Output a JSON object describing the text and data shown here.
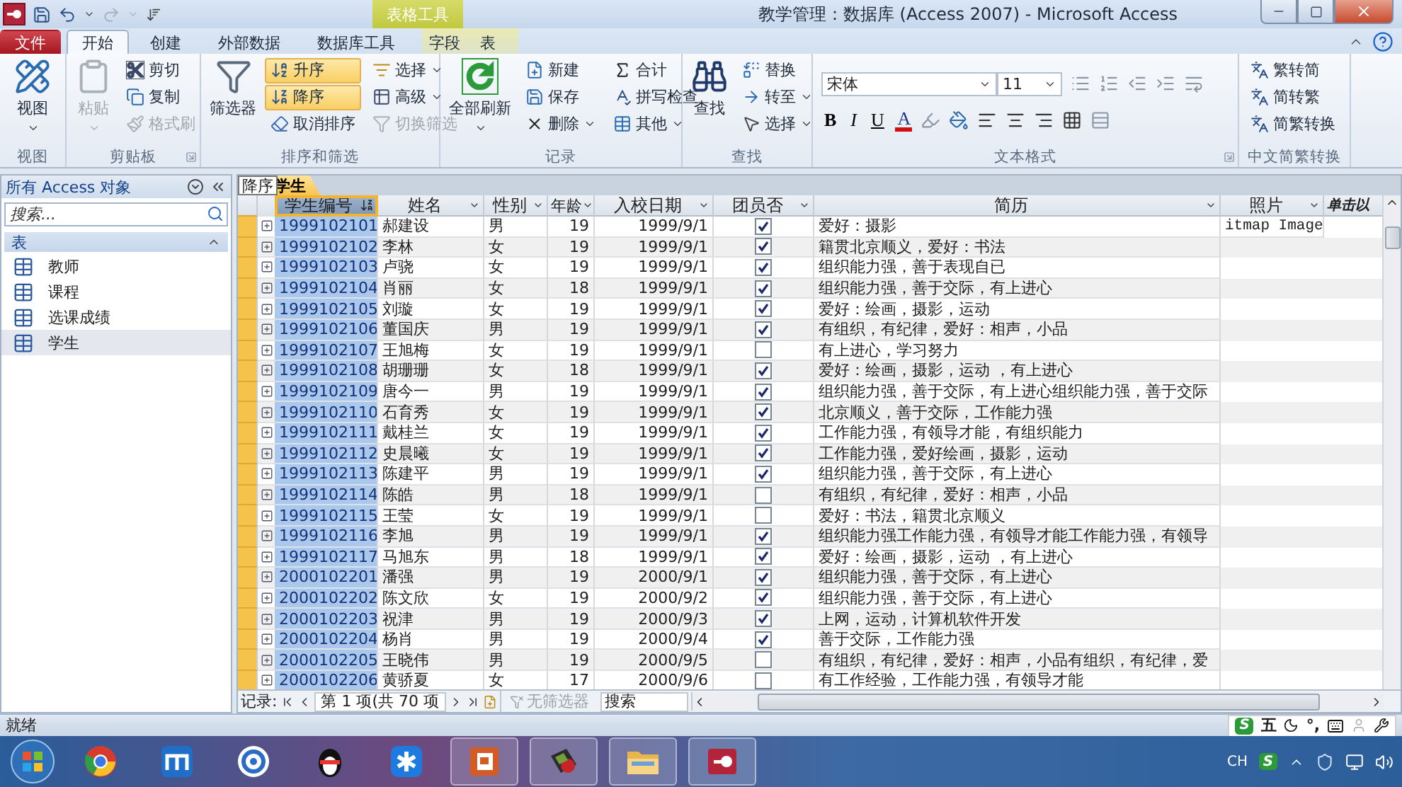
{
  "title_bar": {
    "context_group": "表格工具",
    "title": "教学管理：数据库 (Access 2007)  -  Microsoft Access"
  },
  "tabs": [
    {
      "label": "文件",
      "kind": "file",
      "selected": false
    },
    {
      "label": "开始",
      "kind": "tab",
      "selected": true
    },
    {
      "label": "创建",
      "kind": "tab",
      "selected": false
    },
    {
      "label": "外部数据",
      "kind": "tab",
      "selected": false
    },
    {
      "label": "数据库工具",
      "kind": "tab",
      "selected": false
    },
    {
      "label": "字段",
      "kind": "context",
      "selected": false
    },
    {
      "label": "表",
      "kind": "context",
      "selected": false
    }
  ],
  "ribbon": [
    {
      "kind": "buttons",
      "caption": "视图",
      "launcher": false,
      "items": [
        {
          "kind": "large",
          "label": "视图",
          "dropdown": true,
          "disabled": false,
          "highlighted": false
        }
      ]
    },
    {
      "kind": "buttons",
      "caption": "剪贴板",
      "launcher": true,
      "items": [
        {
          "kind": "large",
          "label": "粘贴",
          "dropdown": true,
          "disabled": true,
          "highlighted": false
        },
        {
          "kind": "small",
          "label": "剪切",
          "dropdown": false,
          "disabled": false,
          "highlighted": false
        },
        {
          "kind": "small",
          "label": "复制",
          "dropdown": false,
          "disabled": false,
          "highlighted": false
        },
        {
          "kind": "small",
          "label": "格式刷",
          "dropdown": false,
          "disabled": true,
          "highlighted": false
        }
      ]
    },
    {
      "kind": "buttons",
      "caption": "排序和筛选",
      "launcher": false,
      "items": [
        {
          "kind": "large",
          "label": "筛选器",
          "dropdown": false,
          "disabled": false,
          "highlighted": false
        },
        {
          "kind": "small",
          "label": "升序",
          "dropdown": false,
          "disabled": false,
          "highlighted": true
        },
        {
          "kind": "small",
          "label": "降序",
          "dropdown": false,
          "disabled": false,
          "highlighted": true
        },
        {
          "kind": "small",
          "label": "取消排序",
          "dropdown": false,
          "disabled": false,
          "highlighted": false
        },
        {
          "kind": "small",
          "label": "选择",
          "dropdown": true,
          "disabled": false,
          "highlighted": false
        },
        {
          "kind": "small",
          "label": "高级",
          "dropdown": true,
          "disabled": false,
          "highlighted": false
        },
        {
          "kind": "small",
          "label": "切换筛选",
          "dropdown": false,
          "disabled": true,
          "highlighted": false
        }
      ]
    },
    {
      "kind": "buttons",
      "caption": "记录",
      "launcher": false,
      "items": [
        {
          "kind": "large",
          "label": "全部刷新",
          "dropdown": true,
          "disabled": false,
          "highlighted": false
        },
        {
          "kind": "small",
          "label": "新建",
          "dropdown": false,
          "disabled": false,
          "highlighted": false
        },
        {
          "kind": "small",
          "label": "保存",
          "dropdown": false,
          "disabled": false,
          "highlighted": false
        },
        {
          "kind": "small",
          "label": "删除",
          "dropdown": true,
          "disabled": false,
          "highlighted": false
        },
        {
          "kind": "small",
          "label": "合计",
          "dropdown": false,
          "disabled": false,
          "highlighted": false
        },
        {
          "kind": "small",
          "label": "拼写检查",
          "dropdown": false,
          "disabled": false,
          "highlighted": false
        },
        {
          "kind": "small",
          "label": "其他",
          "dropdown": true,
          "disabled": false,
          "highlighted": false
        }
      ]
    },
    {
      "kind": "buttons",
      "caption": "查找",
      "launcher": false,
      "items": [
        {
          "kind": "large",
          "label": "查找",
          "dropdown": false,
          "disabled": false,
          "highlighted": false
        },
        {
          "kind": "small",
          "label": "替换",
          "dropdown": false,
          "disabled": false,
          "highlighted": false
        },
        {
          "kind": "small",
          "label": "转至",
          "dropdown": true,
          "disabled": false,
          "highlighted": false
        },
        {
          "kind": "small",
          "label": "选择",
          "dropdown": true,
          "disabled": false,
          "highlighted": false
        }
      ]
    },
    {
      "kind": "text_format",
      "caption": "文本格式",
      "launcher": true,
      "font": "宋体",
      "size": "11",
      "bold": "B",
      "italic": "I",
      "underline": "U",
      "font_color": "A"
    },
    {
      "kind": "buttons",
      "caption": "中文简繁转换",
      "launcher": false,
      "items": [
        {
          "kind": "small",
          "label": "繁转简",
          "dropdown": false,
          "disabled": false,
          "highlighted": false
        },
        {
          "kind": "small",
          "label": "简转繁",
          "dropdown": false,
          "disabled": false,
          "highlighted": false
        },
        {
          "kind": "small",
          "label": "简繁转换",
          "dropdown": false,
          "disabled": false,
          "highlighted": false
        }
      ]
    }
  ],
  "nav_pane": {
    "title": "所有 Access 对象",
    "search_placeholder": "搜索...",
    "section": "表",
    "items": [
      {
        "label": "教师",
        "selected": false
      },
      {
        "label": "课程",
        "selected": false
      },
      {
        "label": "选课成绩",
        "selected": false
      },
      {
        "label": "学生",
        "selected": true
      }
    ]
  },
  "datasheet": {
    "tooltip": "降序",
    "tab": "学生",
    "columns": [
      {
        "label": "学生编号",
        "kind": "field",
        "selected": true,
        "sorted": true
      },
      {
        "label": "姓名",
        "kind": "field",
        "selected": false,
        "sorted": false
      },
      {
        "label": "性别",
        "kind": "field",
        "selected": false,
        "sorted": false
      },
      {
        "label": "年龄",
        "kind": "field",
        "selected": false,
        "sorted": false
      },
      {
        "label": "入校日期",
        "kind": "field",
        "selected": false,
        "sorted": false
      },
      {
        "label": "团员否",
        "kind": "field",
        "selected": false,
        "sorted": false
      },
      {
        "label": "简历",
        "kind": "field",
        "selected": false,
        "sorted": false
      },
      {
        "label": "照片",
        "kind": "field",
        "selected": false,
        "sorted": false
      },
      {
        "label": "单击以",
        "kind": "add_field",
        "selected": false
      }
    ],
    "rows": [
      {
        "cells": [
          "1999102101",
          "郝建设",
          "男",
          "19",
          "1999/9/1"
        ],
        "member": true,
        "resume": "爱好：摄影",
        "photo": "itmap Image"
      },
      {
        "cells": [
          "1999102102",
          "李林",
          "女",
          "19",
          "1999/9/1"
        ],
        "member": true,
        "resume": "籍贯北京顺义，爱好：书法"
      },
      {
        "cells": [
          "1999102103",
          "卢骁",
          "女",
          "19",
          "1999/9/1"
        ],
        "member": true,
        "resume": "组织能力强，善于表现自已"
      },
      {
        "cells": [
          "1999102104",
          "肖丽",
          "女",
          "18",
          "1999/9/1"
        ],
        "member": true,
        "resume": "组织能力强，善于交际，有上进心"
      },
      {
        "cells": [
          "1999102105",
          "刘璇",
          "女",
          "19",
          "1999/9/1"
        ],
        "member": true,
        "resume": "爱好：绘画，摄影，运动"
      },
      {
        "cells": [
          "1999102106",
          "董国庆",
          "男",
          "19",
          "1999/9/1"
        ],
        "member": true,
        "resume": "有组织，有纪律，爱好：相声，小品"
      },
      {
        "cells": [
          "1999102107",
          "王旭梅",
          "女",
          "19",
          "1999/9/1"
        ],
        "member": false,
        "resume": "有上进心，学习努力"
      },
      {
        "cells": [
          "1999102108",
          "胡珊珊",
          "女",
          "18",
          "1999/9/1"
        ],
        "member": true,
        "resume": "爱好：绘画，摄影，运动 ，有上进心"
      },
      {
        "cells": [
          "1999102109",
          "唐今一",
          "男",
          "19",
          "1999/9/1"
        ],
        "member": true,
        "resume": "组织能力强，善于交际，有上进心组织能力强，善于交际"
      },
      {
        "cells": [
          "1999102110",
          "石育秀",
          "女",
          "19",
          "1999/9/1"
        ],
        "member": true,
        "resume": "北京顺义，善于交际，工作能力强"
      },
      {
        "cells": [
          "1999102111",
          "戴桂兰",
          "女",
          "19",
          "1999/9/1"
        ],
        "member": true,
        "resume": "工作能力强，有领导才能，有组织能力"
      },
      {
        "cells": [
          "1999102112",
          "史晨曦",
          "女",
          "19",
          "1999/9/1"
        ],
        "member": true,
        "resume": "工作能力强，爱好绘画，摄影，运动"
      },
      {
        "cells": [
          "1999102113",
          "陈建平",
          "男",
          "19",
          "1999/9/1"
        ],
        "member": true,
        "resume": "组织能力强，善于交际，有上进心"
      },
      {
        "cells": [
          "1999102114",
          "陈皓",
          "男",
          "18",
          "1999/9/1"
        ],
        "member": false,
        "resume": "有组织，有纪律，爱好：相声，小品"
      },
      {
        "cells": [
          "1999102115",
          "王莹",
          "女",
          "19",
          "1999/9/1"
        ],
        "member": false,
        "resume": "爱好：书法，籍贯北京顺义"
      },
      {
        "cells": [
          "1999102116",
          "李旭",
          "男",
          "19",
          "1999/9/1"
        ],
        "member": true,
        "resume": "组织能力强工作能力强，有领导才能工作能力强，有领导"
      },
      {
        "cells": [
          "1999102117",
          "马旭东",
          "男",
          "18",
          "1999/9/1"
        ],
        "member": true,
        "resume": "爱好：绘画，摄影，运动 ，有上进心"
      },
      {
        "cells": [
          "2000102201",
          "潘强",
          "男",
          "19",
          "2000/9/1"
        ],
        "member": true,
        "resume": "组织能力强，善于交际，有上进心"
      },
      {
        "cells": [
          "2000102202",
          "陈文欣",
          "女",
          "19",
          "2000/9/2"
        ],
        "member": true,
        "resume": "组织能力强，善于交际，有上进心"
      },
      {
        "cells": [
          "2000102203",
          "祝津",
          "男",
          "19",
          "2000/9/3"
        ],
        "member": true,
        "resume": "上网，运动，计算机软件开发"
      },
      {
        "cells": [
          "2000102204",
          "杨肖",
          "男",
          "19",
          "2000/9/4"
        ],
        "member": true,
        "resume": "善于交际，工作能力强"
      },
      {
        "cells": [
          "2000102205",
          "王晓伟",
          "男",
          "19",
          "2000/9/5"
        ],
        "member": false,
        "resume": "有组织，有纪律，爱好：相声，小品有组织，有纪律，爱"
      },
      {
        "cells": [
          "2000102206",
          "黄骄夏",
          "女",
          "17",
          "2000/9/6"
        ],
        "member": false,
        "resume": "有工作经验，工作能力强，有领导才能"
      }
    ],
    "record_nav": {
      "label": "记录:",
      "position": "第 1 项(共 70 项",
      "filter": "无筛选器",
      "filter_disabled": true,
      "search_placeholder": "搜索"
    }
  },
  "status_bar": {
    "text": "就绪",
    "ime_logo": "S",
    "ime_mode": "五",
    "ime_punct": "°,"
  },
  "taskbar": {
    "apps": [
      {
        "kind": "chrome",
        "running": false
      },
      {
        "kind": "maxthon",
        "running": false
      },
      {
        "kind": "browser360",
        "running": false
      },
      {
        "kind": "chat",
        "running": false
      },
      {
        "kind": "star",
        "running": false
      },
      {
        "kind": "slides",
        "running": true
      },
      {
        "kind": "media",
        "running": true
      },
      {
        "kind": "folder",
        "running": true
      },
      {
        "kind": "database",
        "running": true
      }
    ],
    "tray": {
      "lang": "CH",
      "ime_logo": "S"
    }
  }
}
